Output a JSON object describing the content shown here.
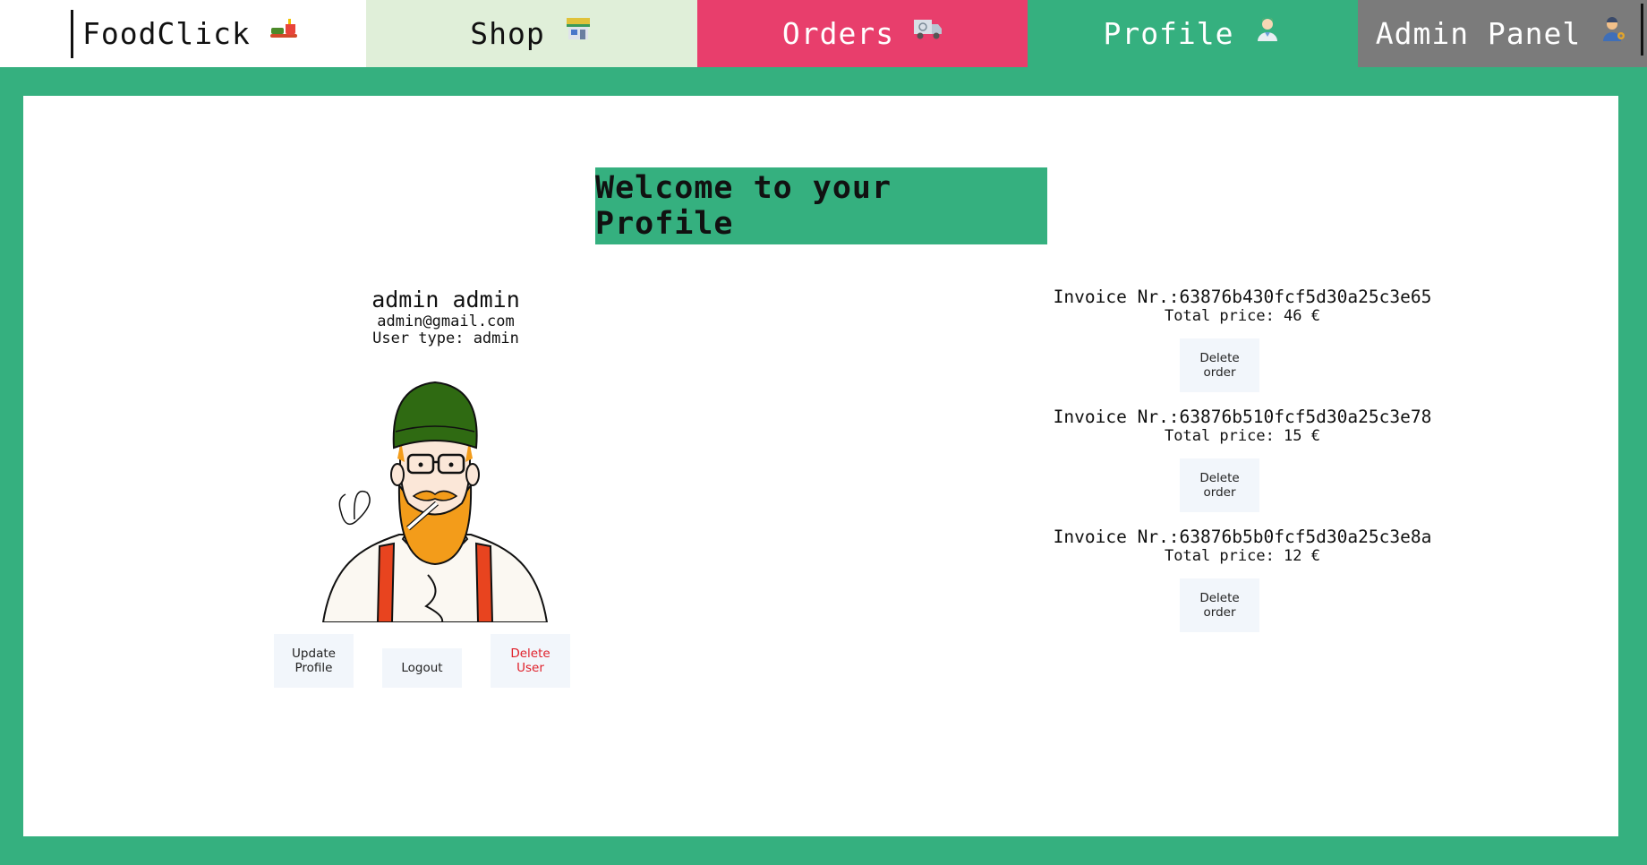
{
  "nav": {
    "brand": "FoodClick",
    "brand_icon": "food-tray-icon",
    "shop": "Shop",
    "shop_icon": "store-icon",
    "orders": "Orders",
    "orders_icon": "delivery-truck-icon",
    "profile": "Profile",
    "profile_icon": "person-icon",
    "admin": "Admin Panel",
    "admin_icon": "admin-person-icon"
  },
  "colors": {
    "accent_green": "#35b07f",
    "shop_bg": "#e0efd9",
    "orders_bg": "#e83e6c",
    "admin_bg": "#7b7b7b",
    "danger": "#e0202a"
  },
  "welcome": "Welcome to your Profile",
  "user": {
    "name": "admin admin",
    "email": "admin@gmail.com",
    "type": "User type: admin",
    "buttons": {
      "update": "Update Profile",
      "logout": "Logout",
      "delete": "Delete User"
    }
  },
  "invoices": [
    {
      "number": "Invoice Nr.:63876b430fcf5d30a25c3e65",
      "total": "Total price: 46 €",
      "delete": "Delete order"
    },
    {
      "number": "Invoice Nr.:63876b510fcf5d30a25c3e78",
      "total": "Total price: 15 €",
      "delete": "Delete order"
    },
    {
      "number": "Invoice Nr.:63876b5b0fcf5d30a25c3e8a",
      "total": "Total price: 12 €",
      "delete": "Delete order"
    }
  ]
}
